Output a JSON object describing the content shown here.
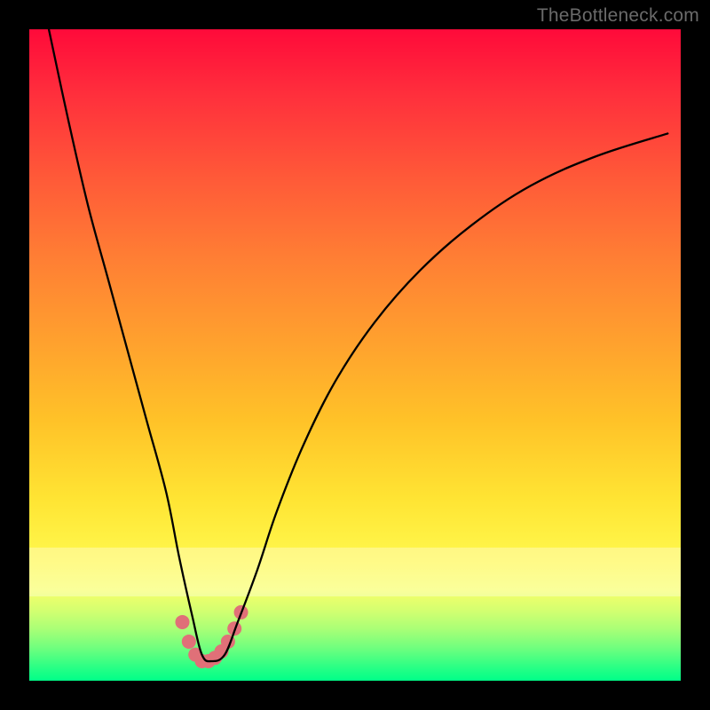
{
  "watermark": "TheBottleneck.com",
  "chart_data": {
    "type": "line",
    "title": "",
    "xlabel": "",
    "ylabel": "",
    "xlim": [
      0,
      100
    ],
    "ylim": [
      0,
      100
    ],
    "background_gradient": {
      "top_color": "#ff0a3a",
      "bottom_color": "#00ff88",
      "stops": [
        {
          "pos": 0.0,
          "color": "#ff0a3a"
        },
        {
          "pos": 0.23,
          "color": "#ff5a38"
        },
        {
          "pos": 0.48,
          "color": "#ffa12e"
        },
        {
          "pos": 0.72,
          "color": "#ffe433"
        },
        {
          "pos": 0.86,
          "color": "#f8ff69"
        },
        {
          "pos": 0.95,
          "color": "#6fff7e"
        },
        {
          "pos": 1.0,
          "color": "#00ff88"
        }
      ]
    },
    "pale_band_y": [
      80,
      87
    ],
    "curve": {
      "x": [
        3,
        6,
        9,
        12,
        15,
        18,
        21,
        23,
        25,
        26.5,
        28,
        30,
        32,
        35,
        38,
        42,
        47,
        53,
        60,
        68,
        77,
        87,
        98
      ],
      "y": [
        100,
        86,
        73,
        62,
        51,
        40,
        29,
        19,
        10,
        4,
        3,
        4,
        9,
        17,
        26,
        36,
        46,
        55,
        63,
        70,
        76,
        80.5,
        84
      ]
    },
    "markers": {
      "x": [
        23.5,
        24.5,
        25.5,
        26.5,
        27.5,
        28.5,
        29.5,
        30.5,
        31.5,
        32.5
      ],
      "y": [
        9.0,
        6.0,
        4.0,
        3.0,
        3.0,
        3.5,
        4.5,
        6.0,
        8.0,
        10.5
      ],
      "color": "#e07078",
      "radius": 8
    }
  }
}
